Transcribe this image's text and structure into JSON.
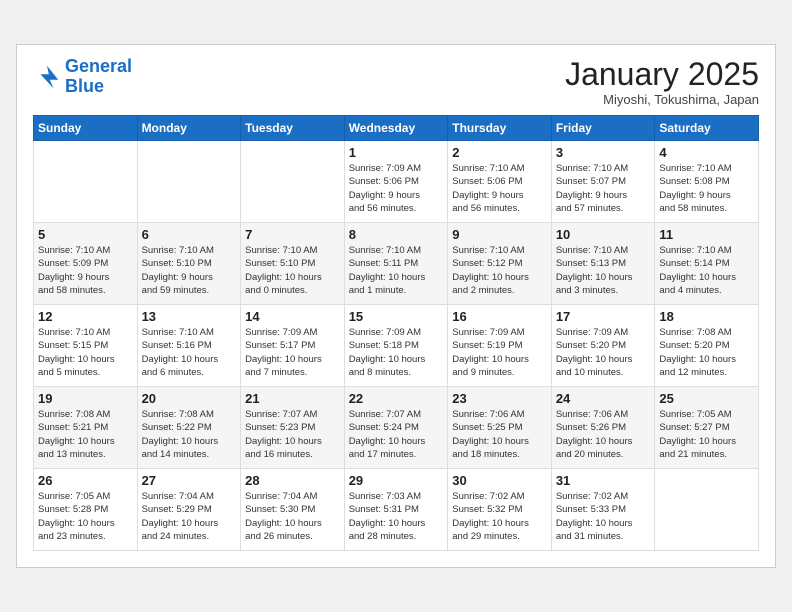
{
  "header": {
    "logo_line1": "General",
    "logo_line2": "Blue",
    "title": "January 2025",
    "location": "Miyoshi, Tokushima, Japan"
  },
  "weekdays": [
    "Sunday",
    "Monday",
    "Tuesday",
    "Wednesday",
    "Thursday",
    "Friday",
    "Saturday"
  ],
  "weeks": [
    [
      {
        "day": "",
        "info": ""
      },
      {
        "day": "",
        "info": ""
      },
      {
        "day": "",
        "info": ""
      },
      {
        "day": "1",
        "info": "Sunrise: 7:09 AM\nSunset: 5:06 PM\nDaylight: 9 hours\nand 56 minutes."
      },
      {
        "day": "2",
        "info": "Sunrise: 7:10 AM\nSunset: 5:06 PM\nDaylight: 9 hours\nand 56 minutes."
      },
      {
        "day": "3",
        "info": "Sunrise: 7:10 AM\nSunset: 5:07 PM\nDaylight: 9 hours\nand 57 minutes."
      },
      {
        "day": "4",
        "info": "Sunrise: 7:10 AM\nSunset: 5:08 PM\nDaylight: 9 hours\nand 58 minutes."
      }
    ],
    [
      {
        "day": "5",
        "info": "Sunrise: 7:10 AM\nSunset: 5:09 PM\nDaylight: 9 hours\nand 58 minutes."
      },
      {
        "day": "6",
        "info": "Sunrise: 7:10 AM\nSunset: 5:10 PM\nDaylight: 9 hours\nand 59 minutes."
      },
      {
        "day": "7",
        "info": "Sunrise: 7:10 AM\nSunset: 5:10 PM\nDaylight: 10 hours\nand 0 minutes."
      },
      {
        "day": "8",
        "info": "Sunrise: 7:10 AM\nSunset: 5:11 PM\nDaylight: 10 hours\nand 1 minute."
      },
      {
        "day": "9",
        "info": "Sunrise: 7:10 AM\nSunset: 5:12 PM\nDaylight: 10 hours\nand 2 minutes."
      },
      {
        "day": "10",
        "info": "Sunrise: 7:10 AM\nSunset: 5:13 PM\nDaylight: 10 hours\nand 3 minutes."
      },
      {
        "day": "11",
        "info": "Sunrise: 7:10 AM\nSunset: 5:14 PM\nDaylight: 10 hours\nand 4 minutes."
      }
    ],
    [
      {
        "day": "12",
        "info": "Sunrise: 7:10 AM\nSunset: 5:15 PM\nDaylight: 10 hours\nand 5 minutes."
      },
      {
        "day": "13",
        "info": "Sunrise: 7:10 AM\nSunset: 5:16 PM\nDaylight: 10 hours\nand 6 minutes."
      },
      {
        "day": "14",
        "info": "Sunrise: 7:09 AM\nSunset: 5:17 PM\nDaylight: 10 hours\nand 7 minutes."
      },
      {
        "day": "15",
        "info": "Sunrise: 7:09 AM\nSunset: 5:18 PM\nDaylight: 10 hours\nand 8 minutes."
      },
      {
        "day": "16",
        "info": "Sunrise: 7:09 AM\nSunset: 5:19 PM\nDaylight: 10 hours\nand 9 minutes."
      },
      {
        "day": "17",
        "info": "Sunrise: 7:09 AM\nSunset: 5:20 PM\nDaylight: 10 hours\nand 10 minutes."
      },
      {
        "day": "18",
        "info": "Sunrise: 7:08 AM\nSunset: 5:20 PM\nDaylight: 10 hours\nand 12 minutes."
      }
    ],
    [
      {
        "day": "19",
        "info": "Sunrise: 7:08 AM\nSunset: 5:21 PM\nDaylight: 10 hours\nand 13 minutes."
      },
      {
        "day": "20",
        "info": "Sunrise: 7:08 AM\nSunset: 5:22 PM\nDaylight: 10 hours\nand 14 minutes."
      },
      {
        "day": "21",
        "info": "Sunrise: 7:07 AM\nSunset: 5:23 PM\nDaylight: 10 hours\nand 16 minutes."
      },
      {
        "day": "22",
        "info": "Sunrise: 7:07 AM\nSunset: 5:24 PM\nDaylight: 10 hours\nand 17 minutes."
      },
      {
        "day": "23",
        "info": "Sunrise: 7:06 AM\nSunset: 5:25 PM\nDaylight: 10 hours\nand 18 minutes."
      },
      {
        "day": "24",
        "info": "Sunrise: 7:06 AM\nSunset: 5:26 PM\nDaylight: 10 hours\nand 20 minutes."
      },
      {
        "day": "25",
        "info": "Sunrise: 7:05 AM\nSunset: 5:27 PM\nDaylight: 10 hours\nand 21 minutes."
      }
    ],
    [
      {
        "day": "26",
        "info": "Sunrise: 7:05 AM\nSunset: 5:28 PM\nDaylight: 10 hours\nand 23 minutes."
      },
      {
        "day": "27",
        "info": "Sunrise: 7:04 AM\nSunset: 5:29 PM\nDaylight: 10 hours\nand 24 minutes."
      },
      {
        "day": "28",
        "info": "Sunrise: 7:04 AM\nSunset: 5:30 PM\nDaylight: 10 hours\nand 26 minutes."
      },
      {
        "day": "29",
        "info": "Sunrise: 7:03 AM\nSunset: 5:31 PM\nDaylight: 10 hours\nand 28 minutes."
      },
      {
        "day": "30",
        "info": "Sunrise: 7:02 AM\nSunset: 5:32 PM\nDaylight: 10 hours\nand 29 minutes."
      },
      {
        "day": "31",
        "info": "Sunrise: 7:02 AM\nSunset: 5:33 PM\nDaylight: 10 hours\nand 31 minutes."
      },
      {
        "day": "",
        "info": ""
      }
    ]
  ]
}
